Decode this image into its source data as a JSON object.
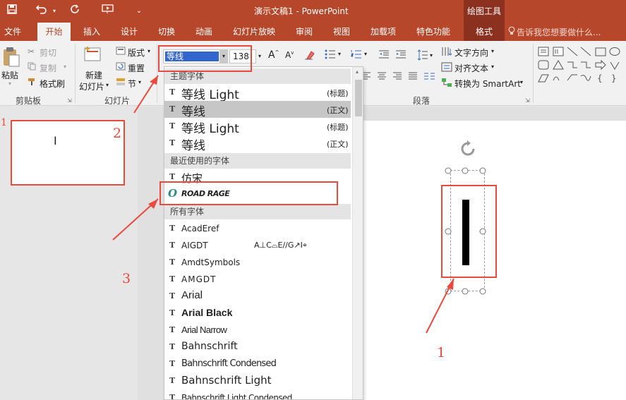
{
  "titlebar": {
    "title": "演示文稿1 - PowerPoint",
    "tools_header": "绘图工具"
  },
  "tabs": {
    "file": "文件",
    "home": "开始",
    "insert": "插入",
    "design": "设计",
    "transitions": "切换",
    "animations": "动画",
    "slideshow": "幻灯片放映",
    "review": "审阅",
    "view": "视图",
    "addins": "加载项",
    "special": "特色功能",
    "format": "格式",
    "tell_me": "告诉我您想要做什么..."
  },
  "ribbon": {
    "paste": "粘贴",
    "cut": "剪切",
    "copy": "复制",
    "format_painter": "格式刷",
    "clipboard": "剪贴板",
    "new_slide_1": "新建",
    "new_slide_2": "幻灯片",
    "layout": "版式",
    "reset": "重置",
    "section": "节",
    "slides_group": "幻灯片",
    "font_value": "等线",
    "size_value": "138",
    "text_direction": "文字方向",
    "align_text": "对齐文本",
    "convert_smartart": "转换为 SmartArt",
    "paragraph": "段落"
  },
  "dropdown": {
    "theme_header": "主题字体",
    "theme_fonts": [
      {
        "name": "等线 Light",
        "tag": "(标题)"
      },
      {
        "name": "等线",
        "tag": "(正文)"
      },
      {
        "name": "等线 Light",
        "tag": "(标题)"
      },
      {
        "name": "等线",
        "tag": "(正文)"
      }
    ],
    "recent_header": "最近使用的字体",
    "recent_fonts": [
      "仿宋",
      "ROAD RAGE"
    ],
    "all_header": "所有字体",
    "all_fonts": [
      "AcadEref",
      "AIGDT",
      "AmdtSymbols",
      "AMGDT",
      "Arial",
      "Arial Black",
      "Arial Narrow",
      "Bahnschrift",
      "Bahnschrift Condensed",
      "Bahnschrift Light",
      "Bahnschrift Light Condensed"
    ],
    "aigdt_sample": "A⊥C⌓E//G↗I⌖",
    "tt_icon": "T",
    "road_rage_icon": "O"
  },
  "thumbnail": {
    "number": "1",
    "text": "I"
  },
  "annotations": {
    "n1_left": "1",
    "n2": "2",
    "n3": "3",
    "n1_right": "1"
  },
  "colors": {
    "accent": "#b7472a",
    "annotation": "#e84a3d",
    "selection": "#3366cc"
  }
}
